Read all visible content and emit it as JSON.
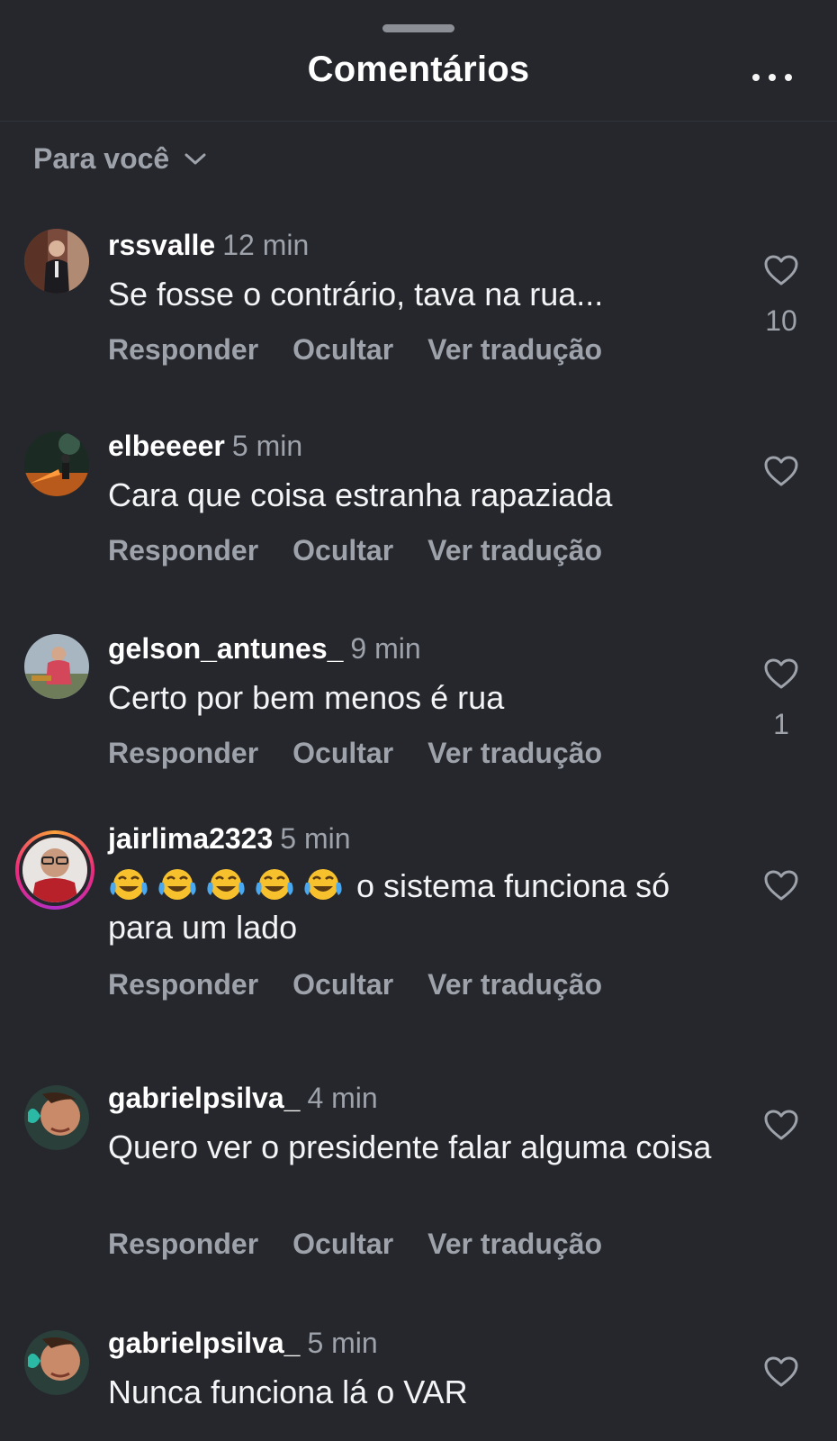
{
  "header": {
    "title": "Comentários",
    "more_icon": "more-horizontal-icon"
  },
  "filter": {
    "label": "Para você",
    "icon": "chevron-down-icon"
  },
  "actions": {
    "reply": "Responder",
    "hide": "Ocultar",
    "translate": "Ver tradução"
  },
  "comments": [
    {
      "username": "rssvalle",
      "time": "12 min",
      "text": "Se fosse o contrário, tava na rua...",
      "likes": "10"
    },
    {
      "username": "elbeeeer",
      "time": "5 min",
      "text": "Cara que coisa estranha rapaziada",
      "likes": ""
    },
    {
      "username": "gelson_antunes_",
      "time": "9 min",
      "text": "Certo por bem menos é rua",
      "likes": "1"
    },
    {
      "username": "jairlima2323",
      "time": "5 min",
      "text": "o sistema funciona só para um lado",
      "emoji": "😂😂😂😂😂",
      "emoji_name": "face-with-tears-of-joy",
      "likes": ""
    },
    {
      "username": "gabrielpsilva_",
      "time": "4 min",
      "text": "Quero ver o presidente falar alguma coisa",
      "likes": ""
    },
    {
      "username": "gabrielpsilva_",
      "time": "5 min",
      "text": "Nunca funciona lá o VAR",
      "likes": ""
    }
  ],
  "colors": {
    "background": "#25272c",
    "text": "#f3f4f6",
    "muted": "#9ea2aa",
    "story_ring_start": "#f9a13a",
    "story_ring_end": "#b12fc6"
  }
}
